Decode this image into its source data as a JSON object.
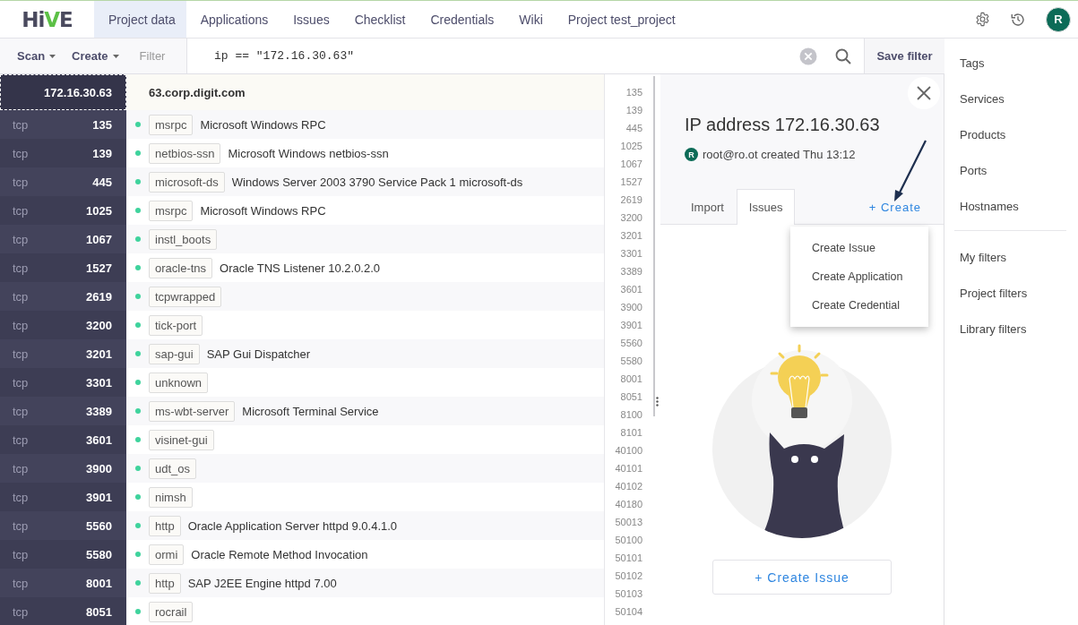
{
  "logo": {
    "text": "HiVE"
  },
  "nav": [
    {
      "label": "Project data",
      "selected": true
    },
    {
      "label": "Applications",
      "selected": false
    },
    {
      "label": "Issues",
      "selected": false
    },
    {
      "label": "Checklist",
      "selected": false
    },
    {
      "label": "Credentials",
      "selected": false
    },
    {
      "label": "Wiki",
      "selected": false
    },
    {
      "label": "Project test_project",
      "selected": false
    }
  ],
  "user_avatar": {
    "initial": "R"
  },
  "toolbar": {
    "menus": [
      {
        "label": "Scan"
      },
      {
        "label": "Create"
      }
    ],
    "filter_label": "Filter",
    "filter_value": "ip == \"172.16.30.63\"",
    "save_button": "Save filter"
  },
  "host": {
    "ip": "172.16.30.63",
    "hostname": "63.corp.digit.com",
    "selected": true
  },
  "ports": [
    {
      "protocol": "tcp",
      "port": "135",
      "service": "msrpc",
      "product": "Microsoft Windows RPC"
    },
    {
      "protocol": "tcp",
      "port": "139",
      "service": "netbios-ssn",
      "product": "Microsoft Windows netbios-ssn"
    },
    {
      "protocol": "tcp",
      "port": "445",
      "service": "microsoft-ds",
      "product": "Windows Server 2003 3790 Service Pack 1 microsoft-ds"
    },
    {
      "protocol": "tcp",
      "port": "1025",
      "service": "msrpc",
      "product": "Microsoft Windows RPC"
    },
    {
      "protocol": "tcp",
      "port": "1067",
      "service": "instl_boots"
    },
    {
      "protocol": "tcp",
      "port": "1527",
      "service": "oracle-tns",
      "product": "Oracle TNS Listener 10.2.0.2.0"
    },
    {
      "protocol": "tcp",
      "port": "2619",
      "service": "tcpwrapped"
    },
    {
      "protocol": "tcp",
      "port": "3200",
      "service": "tick-port"
    },
    {
      "protocol": "tcp",
      "port": "3201",
      "service": "sap-gui",
      "product": "SAP Gui Dispatcher"
    },
    {
      "protocol": "tcp",
      "port": "3301",
      "service": "unknown"
    },
    {
      "protocol": "tcp",
      "port": "3389",
      "service": "ms-wbt-server",
      "product": "Microsoft Terminal Service"
    },
    {
      "protocol": "tcp",
      "port": "3601",
      "service": "visinet-gui"
    },
    {
      "protocol": "tcp",
      "port": "3900",
      "service": "udt_os"
    },
    {
      "protocol": "tcp",
      "port": "3901",
      "service": "nimsh"
    },
    {
      "protocol": "tcp",
      "port": "5560",
      "service": "http",
      "product": "Oracle Application Server httpd 9.0.4.1.0"
    },
    {
      "protocol": "tcp",
      "port": "5580",
      "service": "ormi",
      "product": "Oracle Remote Method Invocation"
    },
    {
      "protocol": "tcp",
      "port": "8001",
      "service": "http",
      "product": "SAP J2EE Engine httpd 7.00"
    },
    {
      "protocol": "tcp",
      "port": "8051",
      "service": "rocrail"
    }
  ],
  "port_index": [
    "135",
    "139",
    "445",
    "1025",
    "1067",
    "1527",
    "2619",
    "3200",
    "3201",
    "3301",
    "3389",
    "3601",
    "3900",
    "3901",
    "5560",
    "5580",
    "8001",
    "8051",
    "8100",
    "8101",
    "40100",
    "40101",
    "40102",
    "40180",
    "50013",
    "50100",
    "50101",
    "50102",
    "50103",
    "50104"
  ],
  "detail": {
    "title": "IP address 172.16.30.63",
    "author_initial": "R",
    "created": "root@ro.ot created Thu 13:12",
    "tabs": [
      {
        "label": "Import",
        "selected": false
      },
      {
        "label": "Issues",
        "selected": true
      }
    ],
    "create_link": "+ Create",
    "menu": {
      "open": true,
      "items": [
        {
          "label": "Create Issue"
        },
        {
          "label": "Create Application"
        },
        {
          "label": "Create Credential"
        }
      ]
    },
    "create_issue_button": "+ Create Issue"
  },
  "sidebar": {
    "groups": [
      {
        "items": [
          {
            "label": "Tags"
          },
          {
            "label": "Services"
          },
          {
            "label": "Products"
          },
          {
            "label": "Ports"
          },
          {
            "label": "Hostnames"
          }
        ]
      },
      {
        "items": [
          {
            "label": "My filters"
          },
          {
            "label": "Project filters"
          },
          {
            "label": "Library filters"
          }
        ]
      }
    ]
  }
}
